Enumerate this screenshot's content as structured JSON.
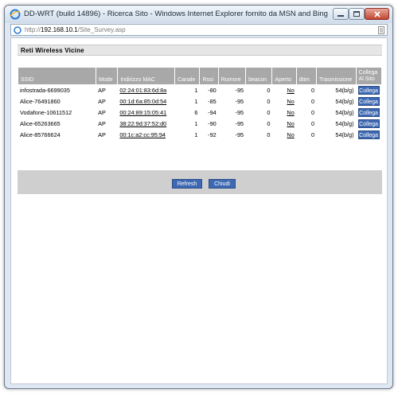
{
  "window": {
    "title": "DD-WRT (build 14896) - Ricerca Sito - Windows Internet Explorer fornito da MSN and Bing"
  },
  "address": {
    "prefix": "http://",
    "host": "192.168.10.1",
    "path": "/Site_Survey.asp"
  },
  "survey": {
    "heading": "Reti Wireless Vicine",
    "columns": [
      "SSID",
      "Mode",
      "Indirizzo MAC",
      "Canale",
      "Rssi",
      "Rumore",
      "beacon",
      "Aperto",
      "dtim",
      "Trasmissione",
      "Collega Al Sito"
    ],
    "join_label": "Collega",
    "rows": [
      {
        "ssid": "infostrada-6699035",
        "mode": "AP",
        "mac": "02:24:01:83:6d:8a",
        "channel": "1",
        "rssi": "-80",
        "noise": "-95",
        "beacon": "0",
        "open": "No",
        "dtim": "0",
        "rate": "54(b/g)"
      },
      {
        "ssid": "Alice-76491860",
        "mode": "AP",
        "mac": "00:1d:6a:85:0d:54",
        "channel": "1",
        "rssi": "-85",
        "noise": "-95",
        "beacon": "0",
        "open": "No",
        "dtim": "0",
        "rate": "54(b/g)"
      },
      {
        "ssid": "Vodafone-10611512",
        "mode": "AP",
        "mac": "00:24:89:15:05:41",
        "channel": "6",
        "rssi": "-94",
        "noise": "-95",
        "beacon": "0",
        "open": "No",
        "dtim": "0",
        "rate": "54(b/g)"
      },
      {
        "ssid": "Alice-65263665",
        "mode": "AP",
        "mac": "38:22:9d:37:52:d0",
        "channel": "1",
        "rssi": "-90",
        "noise": "-95",
        "beacon": "0",
        "open": "No",
        "dtim": "0",
        "rate": "54(b/g)"
      },
      {
        "ssid": "Alice-85766624",
        "mode": "AP",
        "mac": "00:1c:a2:cc:95:94",
        "channel": "1",
        "rssi": "-92",
        "noise": "-95",
        "beacon": "0",
        "open": "No",
        "dtim": "0",
        "rate": "54(b/g)"
      }
    ]
  },
  "buttons": {
    "refresh": "Refresh",
    "close": "Chiudi"
  }
}
